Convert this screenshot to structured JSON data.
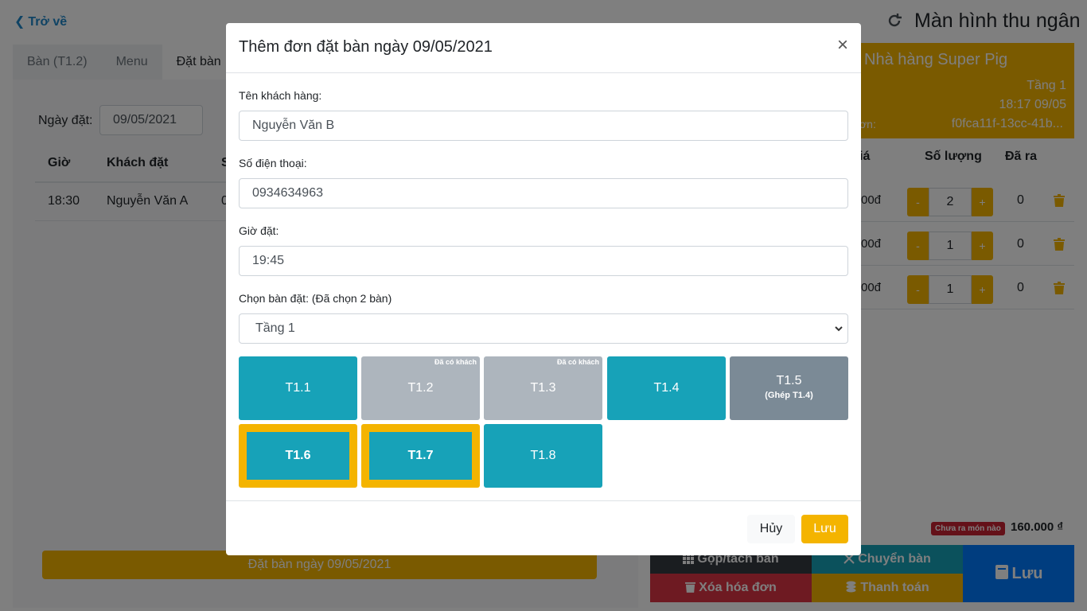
{
  "header": {
    "back_label": "Trở về",
    "screen_title": "Màn hình thu ngân",
    "tabs": [
      "Bàn (T1.2)",
      "Menu",
      "Đặt bàn"
    ]
  },
  "booking_list": {
    "date_label": "Ngày đặt:",
    "date_value": "09/05/2021",
    "columns": [
      "Giờ",
      "Khách đặt",
      "S"
    ],
    "rows": [
      {
        "time": "18:30",
        "customer": "Nguyễn Văn A",
        "extra": "0"
      }
    ],
    "book_button": "Đặt bàn ngày 09/05/2021"
  },
  "order_panel": {
    "restaurant_name": "Nhà hàng Super Pig",
    "floor": "Tầng 1",
    "time": "18:17 09/05",
    "id_label": "ơn:",
    "id_value": "f0fca11f-13cc-41b...",
    "columns": [
      "iá",
      "Số lượng",
      "Đã ra"
    ],
    "items": [
      {
        "price": "00đ",
        "minus": "-",
        "qty": "2",
        "plus": "+",
        "served": "0"
      },
      {
        "price": "00đ",
        "minus": "-",
        "qty": "1",
        "plus": "+",
        "served": "0"
      },
      {
        "price": "00đ",
        "minus": "-",
        "qty": "1",
        "plus": "+",
        "served": "0"
      }
    ],
    "status_badge": "Chưa ra món nào",
    "total": "160.000 ₫",
    "actions": {
      "merge": "Gộp/tách bàn",
      "move": "Chuyển bàn",
      "delete": "Xóa hóa đơn",
      "pay": "Thanh toán",
      "save": "Lưu"
    }
  },
  "modal": {
    "title": "Thêm đơn đặt bàn ngày 09/05/2021",
    "close": "×",
    "customer_label": "Tên khách hàng:",
    "customer_value": "Nguyễn Văn B",
    "phone_label": "Số điện thoại:",
    "phone_value": "0934634963",
    "time_label": "Giờ đặt:",
    "time_value": "19:45",
    "tables_label": "Chọn bàn đặt: (Đã chọn 2 bàn)",
    "floor_option": "Tầng 1",
    "busy_note": "Đã có khách",
    "tables": [
      {
        "name": "T1.1",
        "state": "free"
      },
      {
        "name": "T1.2",
        "state": "busy"
      },
      {
        "name": "T1.3",
        "state": "busy"
      },
      {
        "name": "T1.4",
        "state": "free"
      },
      {
        "name": "T1.5",
        "state": "merged",
        "note": "(Ghép T1.4)"
      },
      {
        "name": "T1.6",
        "state": "selected"
      },
      {
        "name": "T1.7",
        "state": "selected"
      },
      {
        "name": "T1.8",
        "state": "free"
      }
    ],
    "cancel": "Hủy",
    "save": "Lưu"
  },
  "colors": {
    "accent": "#f4b400",
    "table_free": "#17a2b8",
    "table_busy": "#adb5bd",
    "table_merged": "#7b8a96"
  }
}
